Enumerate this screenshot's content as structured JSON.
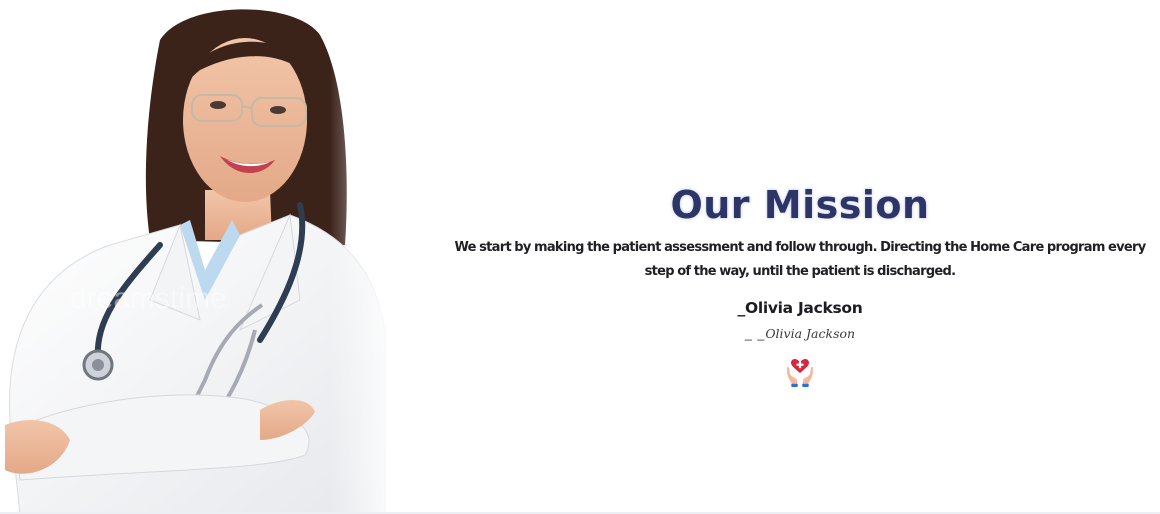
{
  "mission": {
    "title": "Our Mission",
    "description": "We start by making the patient assessment and follow through. Directing the Home Care program every step of the way, until the patient is discharged.",
    "author": "_Olivia Jackson",
    "signature_prefix": "_ _",
    "signature_name": "Olivia Jackson",
    "icon": "hands-heart-icon"
  },
  "photo": {
    "subject": "doctor-portrait",
    "watermark": "dreamstime"
  },
  "colors": {
    "title": "#2c3565",
    "text": "#1f1f24",
    "icon_heart": "#d7263d",
    "icon_hands": "#f4b89a",
    "icon_cuffs": "#2a6fd6"
  }
}
